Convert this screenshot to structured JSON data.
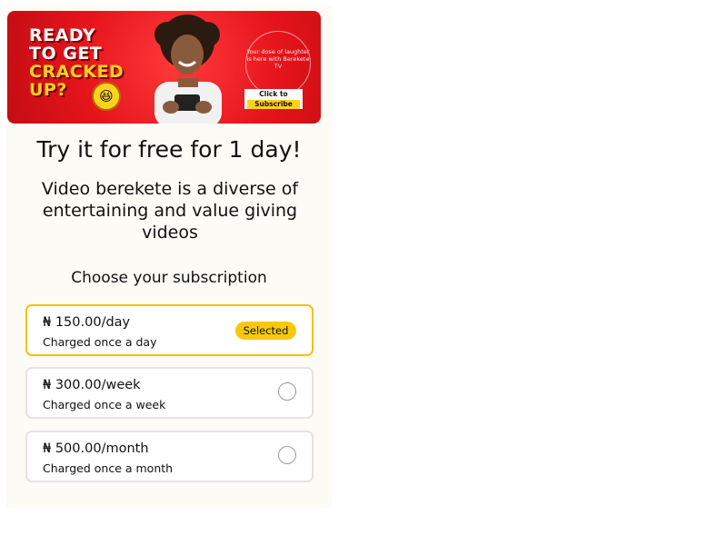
{
  "banner": {
    "headline_line1": "READY",
    "headline_line2": "TO GET",
    "headline_line3": "CRACKED",
    "headline_line4": "UP?",
    "tagline": "Your dose of laughter is here with Berekete TV",
    "cta_line1": "Click to",
    "cta_line2": "Subscribe"
  },
  "title": "Try it for free for 1 day!",
  "description": "Video berekete is a diverse of entertaining and value giving videos",
  "choose_label": "Choose your subscription",
  "plans": [
    {
      "price": "₦ 150.00/day",
      "note": "Charged once a day",
      "selected": true,
      "badge": "Selected"
    },
    {
      "price": "₦ 300.00/week",
      "note": "Charged once a week",
      "selected": false
    },
    {
      "price": "₦ 500.00/month",
      "note": "Charged once a month",
      "selected": false
    }
  ],
  "colors": {
    "accent": "#f9c80e",
    "banner_red": "#e5141b",
    "background": "#fdfbf5"
  }
}
